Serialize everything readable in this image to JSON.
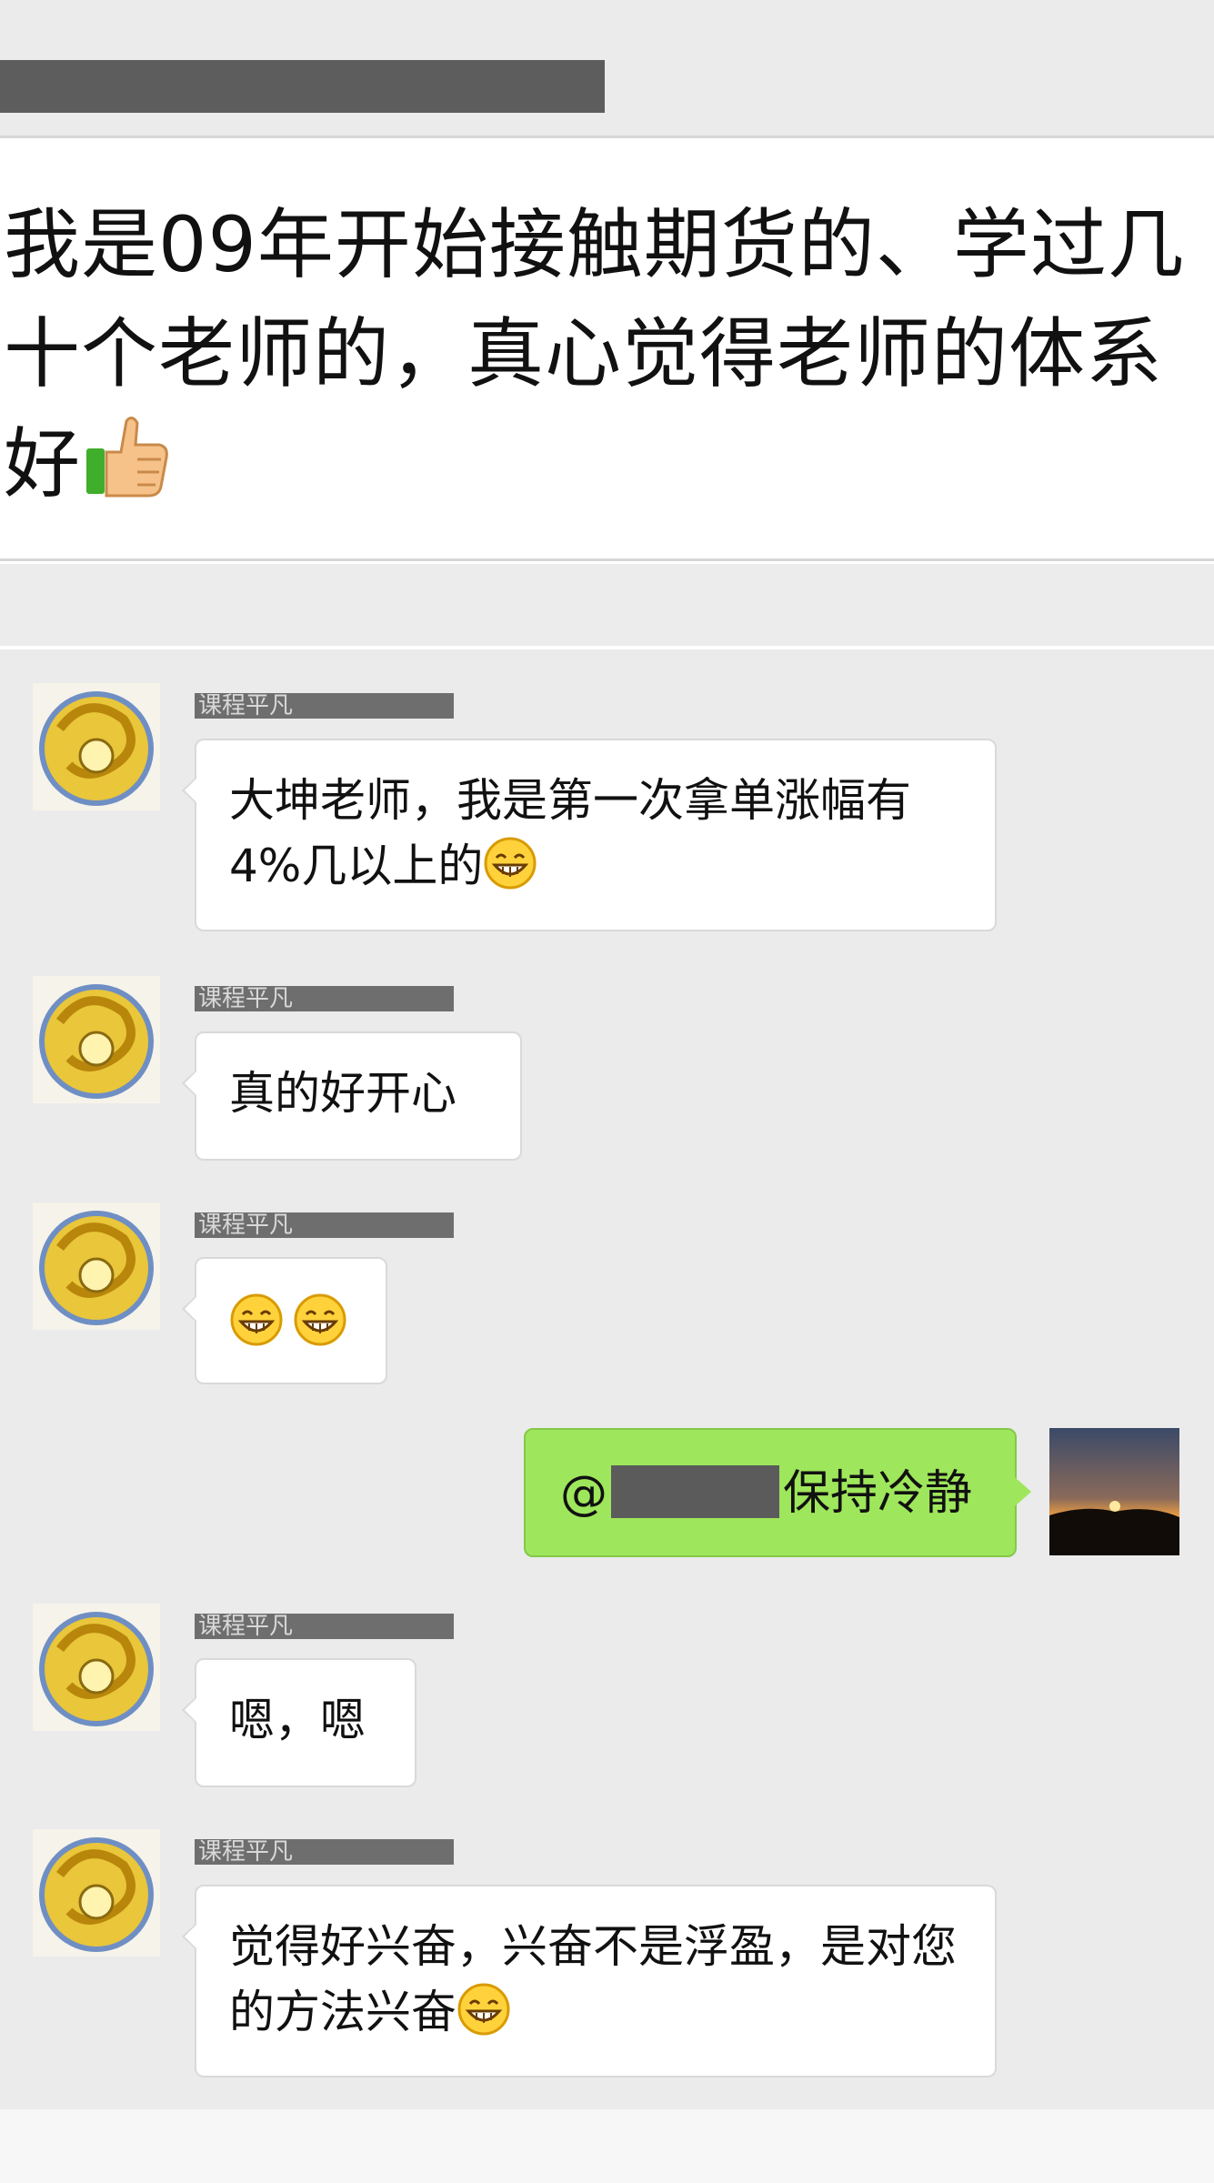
{
  "post": {
    "quote_text": "我是09年开始接触期货的、学过几十个老师的，真心觉得老师的体系好",
    "reaction_icon": "thumbs-up-icon"
  },
  "chat": {
    "sender_name": "课程平凡",
    "messages": [
      {
        "text": "大坤老师，我是第一次拿单涨幅有4%几以上的",
        "emoji": "grin-emoji"
      },
      {
        "text": "真的好开心"
      },
      {
        "emojis": [
          "grin-emoji",
          "grin-emoji"
        ]
      },
      {
        "mention_prefix": "@",
        "text": "保持冷静",
        "outgoing": true
      },
      {
        "text": "嗯，嗯"
      },
      {
        "text": "觉得好兴奋，兴奋不是浮盈，是对您的方法兴奋",
        "emoji": "grin-emoji"
      }
    ]
  }
}
